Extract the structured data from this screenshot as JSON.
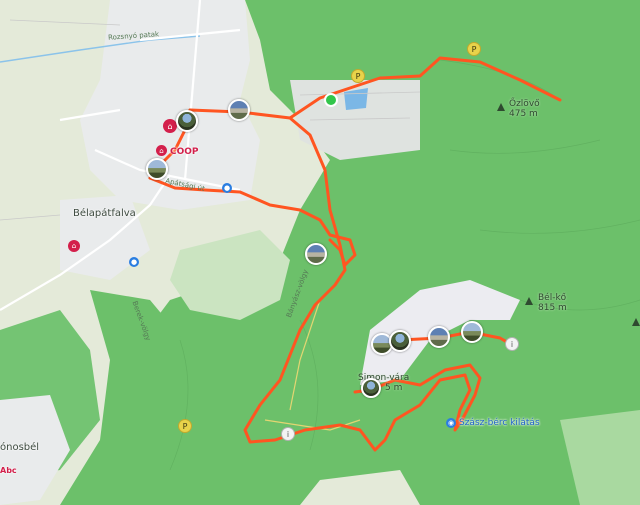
{
  "map": {
    "places": {
      "town": "Bélapátfalva",
      "west_village": "ónosbél",
      "abc_shop": "Abc"
    },
    "roads": {
      "north": "Rozsnyó patak",
      "main": "Apátsági út",
      "forest_1": "Bányász-völgy",
      "forest_2": "Berek-völgy"
    },
    "pois": {
      "coop": "COOP",
      "viewpoint": "Szász-bérc kilátás",
      "castle": "Simon-vára",
      "castle_elev_suffix": "5 m"
    },
    "peaks": [
      {
        "name": "Őzlövő",
        "elev": "475 m"
      },
      {
        "name": "Bél-kő",
        "elev": "815 m"
      }
    ],
    "icons": [
      "photo-thumbnail",
      "shop-icon",
      "water-icon",
      "viewpoint-icon",
      "peak-icon",
      "parking-icon",
      "start-point-icon"
    ],
    "colors": {
      "route": "#ff5521",
      "forest": "#6cc06a",
      "forest_light": "#9ed496",
      "quarry": "#eaeaef",
      "urban": "#e6e9ea",
      "water": "#7bb7e6"
    }
  }
}
